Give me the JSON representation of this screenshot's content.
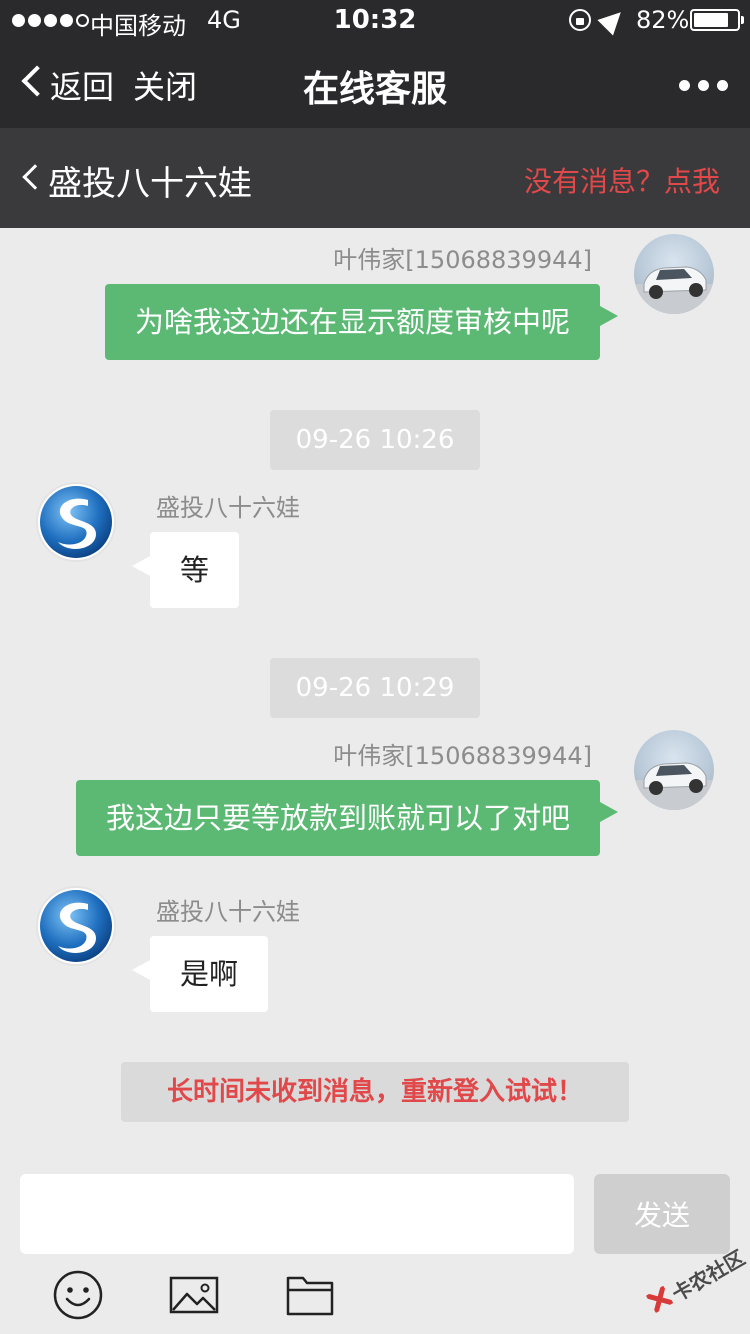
{
  "status_bar": {
    "carrier": "中国移动",
    "network": "4G",
    "time": "10:32",
    "battery_percent_label": "82%",
    "battery_level": 0.82
  },
  "nav": {
    "back_label": "返回",
    "close_label": "关闭",
    "title": "在线客服",
    "more_icon": "more-dots-icon"
  },
  "chat_header": {
    "contact_name": "盛投八十六娃",
    "no_message_link": "没有消息？点我"
  },
  "messages": [
    {
      "side": "right",
      "sender": "叶伟家[15068839944]",
      "text": "为啥我这边还在显示额度审核中呢"
    },
    {
      "type": "time",
      "text": "09-26 10:26"
    },
    {
      "side": "left",
      "sender": "盛投八十六娃",
      "text": "等"
    },
    {
      "type": "time",
      "text": "09-26 10:29"
    },
    {
      "side": "right",
      "sender": "叶伟家[15068839944]",
      "text": "我这边只要等放款到账就可以了对吧"
    },
    {
      "side": "left",
      "sender": "盛投八十六娃",
      "text": "是啊"
    }
  ],
  "notice": "长时间未收到消息，重新登入试试！",
  "composer": {
    "input_value": "",
    "input_placeholder": "",
    "send_label": "发送"
  },
  "toolbar": {
    "icons": [
      "emoji-icon",
      "image-icon",
      "folder-icon"
    ]
  },
  "watermark": "卡农社区",
  "colors": {
    "bar_dark": "#2a2a2c",
    "header_dark": "#3a3a3c",
    "accent_red": "#e0484a",
    "bubble_green": "#5bb974",
    "background": "#ebebeb"
  }
}
